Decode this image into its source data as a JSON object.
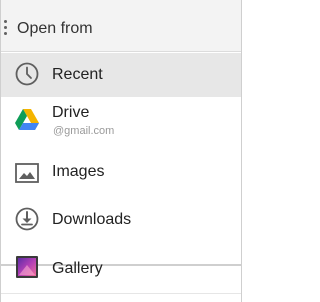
{
  "header": {
    "title": "Open from",
    "menu_icon": "overflow-menu-icon"
  },
  "items": [
    {
      "label": "Recent",
      "icon": "clock-icon",
      "selected": true
    },
    {
      "label": "Drive",
      "sublabel": "@gmail.com",
      "icon": "google-drive-icon"
    },
    {
      "label": "Images",
      "icon": "image-icon"
    },
    {
      "label": "Downloads",
      "icon": "download-icon"
    },
    {
      "label": "Gallery",
      "icon": "gallery-icon"
    }
  ],
  "colors": {
    "header_background": "#f3f3f3",
    "selected_background": "#e7e7e7",
    "text": "#222222",
    "secondary_text": "#9a9a9a",
    "drive_green": "#0f9d58",
    "drive_yellow": "#f4b400",
    "drive_blue": "#4285f4",
    "gallery_purple": "#7b2cbf"
  }
}
